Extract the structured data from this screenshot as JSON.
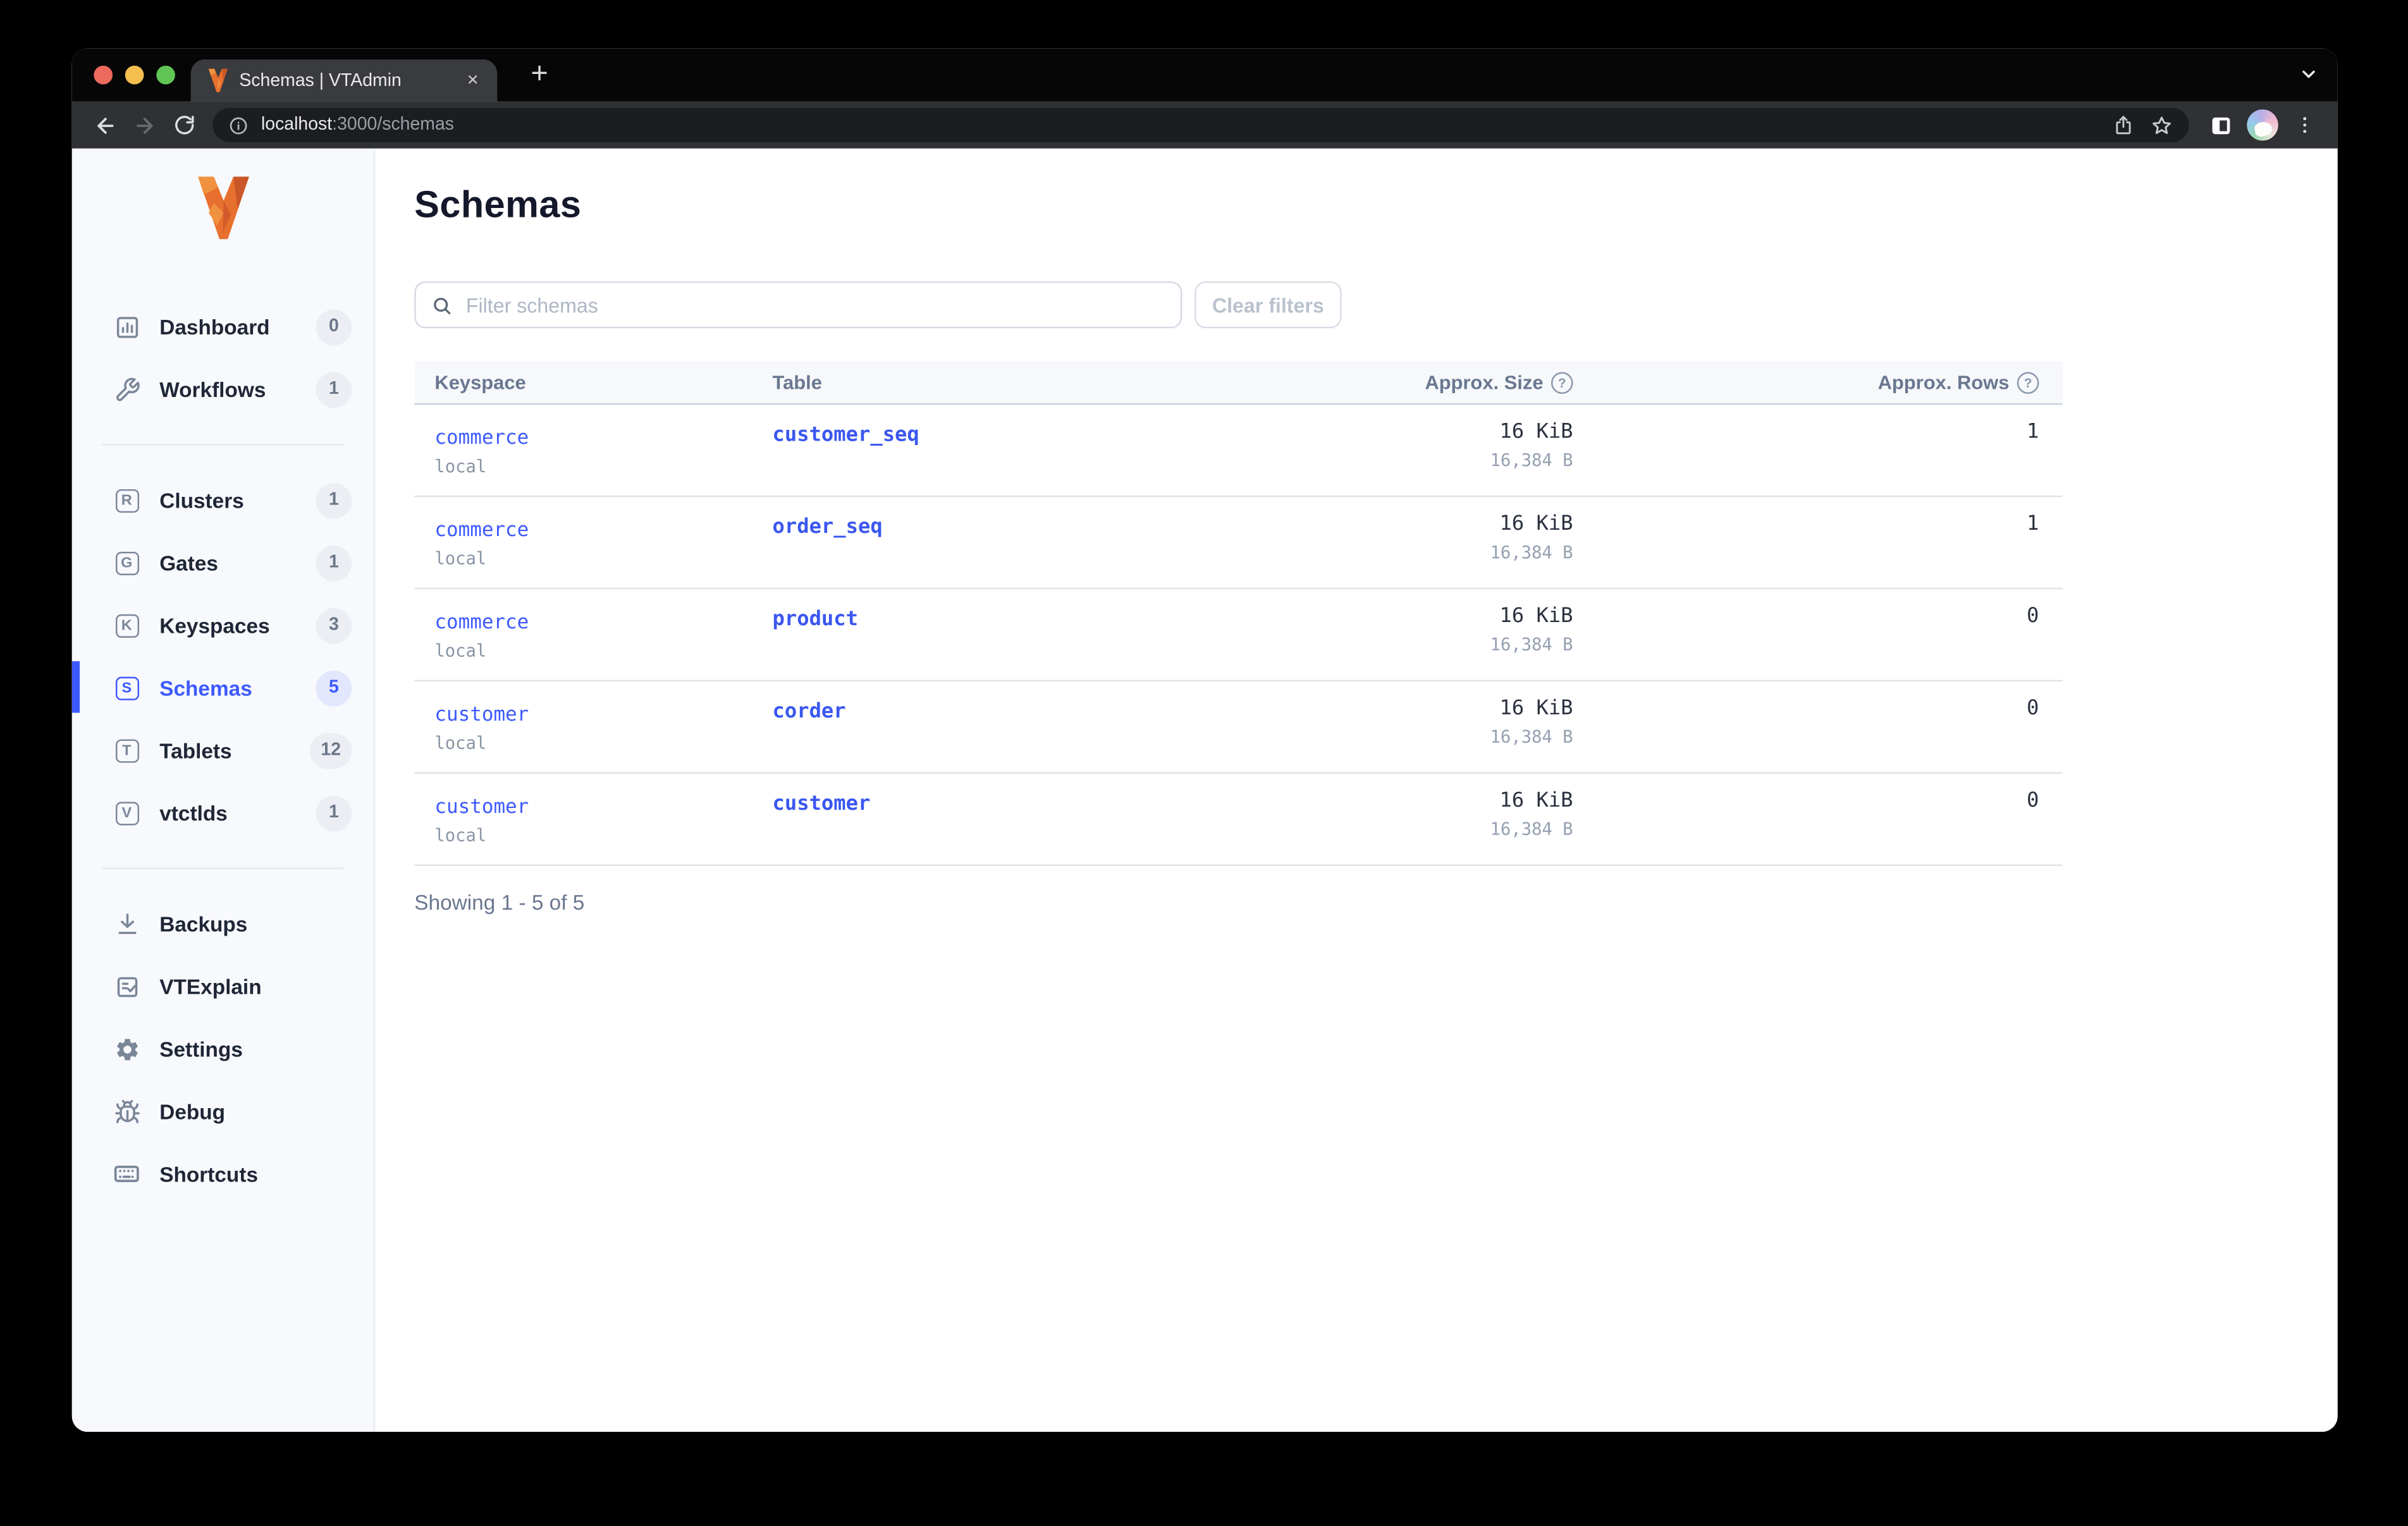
{
  "browser": {
    "tab_title": "Schemas | VTAdmin",
    "close_glyph": "×",
    "new_tab_glyph": "+",
    "url_host": "localhost",
    "url_rest": ":3000/schemas",
    "url_full": "localhost:3000/schemas",
    "traffic_lights": {
      "red": "#ed6a5e",
      "yellow": "#f4bf4f",
      "green": "#61c555"
    }
  },
  "sidebar": {
    "groups": [
      {
        "items": [
          {
            "label": "Dashboard",
            "badge": "0",
            "icon": "dashboard"
          },
          {
            "label": "Workflows",
            "badge": "1",
            "icon": "wrench"
          }
        ]
      },
      {
        "items": [
          {
            "label": "Clusters",
            "badge": "1",
            "icon_letter": "R"
          },
          {
            "label": "Gates",
            "badge": "1",
            "icon_letter": "G"
          },
          {
            "label": "Keyspaces",
            "badge": "3",
            "icon_letter": "K"
          },
          {
            "label": "Schemas",
            "badge": "5",
            "icon_letter": "S",
            "active": true
          },
          {
            "label": "Tablets",
            "badge": "12",
            "icon_letter": "T"
          },
          {
            "label": "vtctlds",
            "badge": "1",
            "icon_letter": "V"
          }
        ]
      },
      {
        "items": [
          {
            "label": "Backups",
            "icon": "download"
          },
          {
            "label": "VTExplain",
            "icon": "doc-check"
          },
          {
            "label": "Settings",
            "icon": "gear"
          }
        ]
      },
      {
        "items": [
          {
            "label": "Debug",
            "icon": "bug"
          },
          {
            "label": "Shortcuts",
            "icon": "keyboard"
          }
        ]
      }
    ]
  },
  "main": {
    "title": "Schemas",
    "filter_placeholder": "Filter schemas",
    "clear_filters_label": "Clear filters",
    "help_glyph": "?",
    "table": {
      "columns": [
        "Keyspace",
        "Table",
        "Approx. Size",
        "Approx. Rows"
      ],
      "rows": [
        {
          "keyspace": "commerce",
          "cluster": "local",
          "table": "customer_seq",
          "size": "16 KiB",
          "size_bytes": "16,384 B",
          "rows": "1"
        },
        {
          "keyspace": "commerce",
          "cluster": "local",
          "table": "order_seq",
          "size": "16 KiB",
          "size_bytes": "16,384 B",
          "rows": "1"
        },
        {
          "keyspace": "commerce",
          "cluster": "local",
          "table": "product",
          "size": "16 KiB",
          "size_bytes": "16,384 B",
          "rows": "0"
        },
        {
          "keyspace": "customer",
          "cluster": "local",
          "table": "corder",
          "size": "16 KiB",
          "size_bytes": "16,384 B",
          "rows": "0"
        },
        {
          "keyspace": "customer",
          "cluster": "local",
          "table": "customer",
          "size": "16 KiB",
          "size_bytes": "16,384 B",
          "rows": "0"
        }
      ]
    },
    "summary": "Showing 1 - 5 of 5"
  },
  "colors": {
    "accent": "#3d5afe",
    "logo_orange": "#e8702e"
  }
}
